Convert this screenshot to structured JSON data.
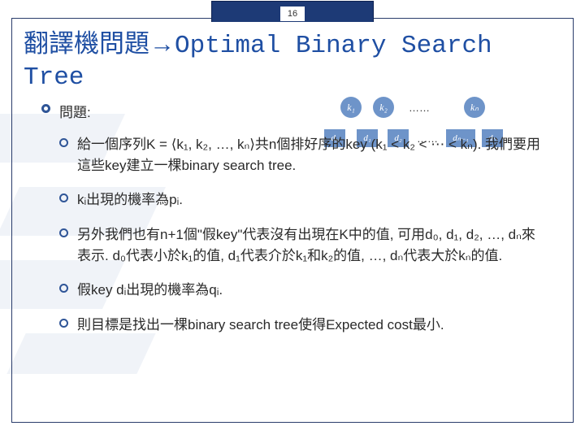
{
  "page_number": "16",
  "title_part1": "翻譯機問題",
  "title_arrow": "→",
  "title_part2": "Optimal Binary Search Tree",
  "problem_label": "問題:",
  "bullets": {
    "b1": "給一個序列K = ⟨k₁, k₂, …, kₙ⟩共n個排好序的key (k₁ < k₂ < ⋯ < kₙ). 我們要用這些key建立一棵binary search tree.",
    "b2": "kᵢ出現的機率為pᵢ.",
    "b3": "另外我們也有n+1個\"假key\"代表沒有出現在K中的值, 可用d₀, d₁, d₂, …, dₙ來表示. d₀代表小於k₁的值, d₁代表介於k₁和k₂的值, …, dₙ代表大於kₙ的值.",
    "b4": "假key dᵢ出現的機率為qᵢ.",
    "b5": "則目標是找出一棵binary search tree使得Expected cost最小."
  },
  "diagram": {
    "k1": "k₁",
    "k2": "k₂",
    "kn": "kₙ",
    "d0": "d₀",
    "d1": "d₁",
    "d2": "d₂",
    "dn1": "dₙ₋₁",
    "dn": "dₙ",
    "dots": "……"
  }
}
